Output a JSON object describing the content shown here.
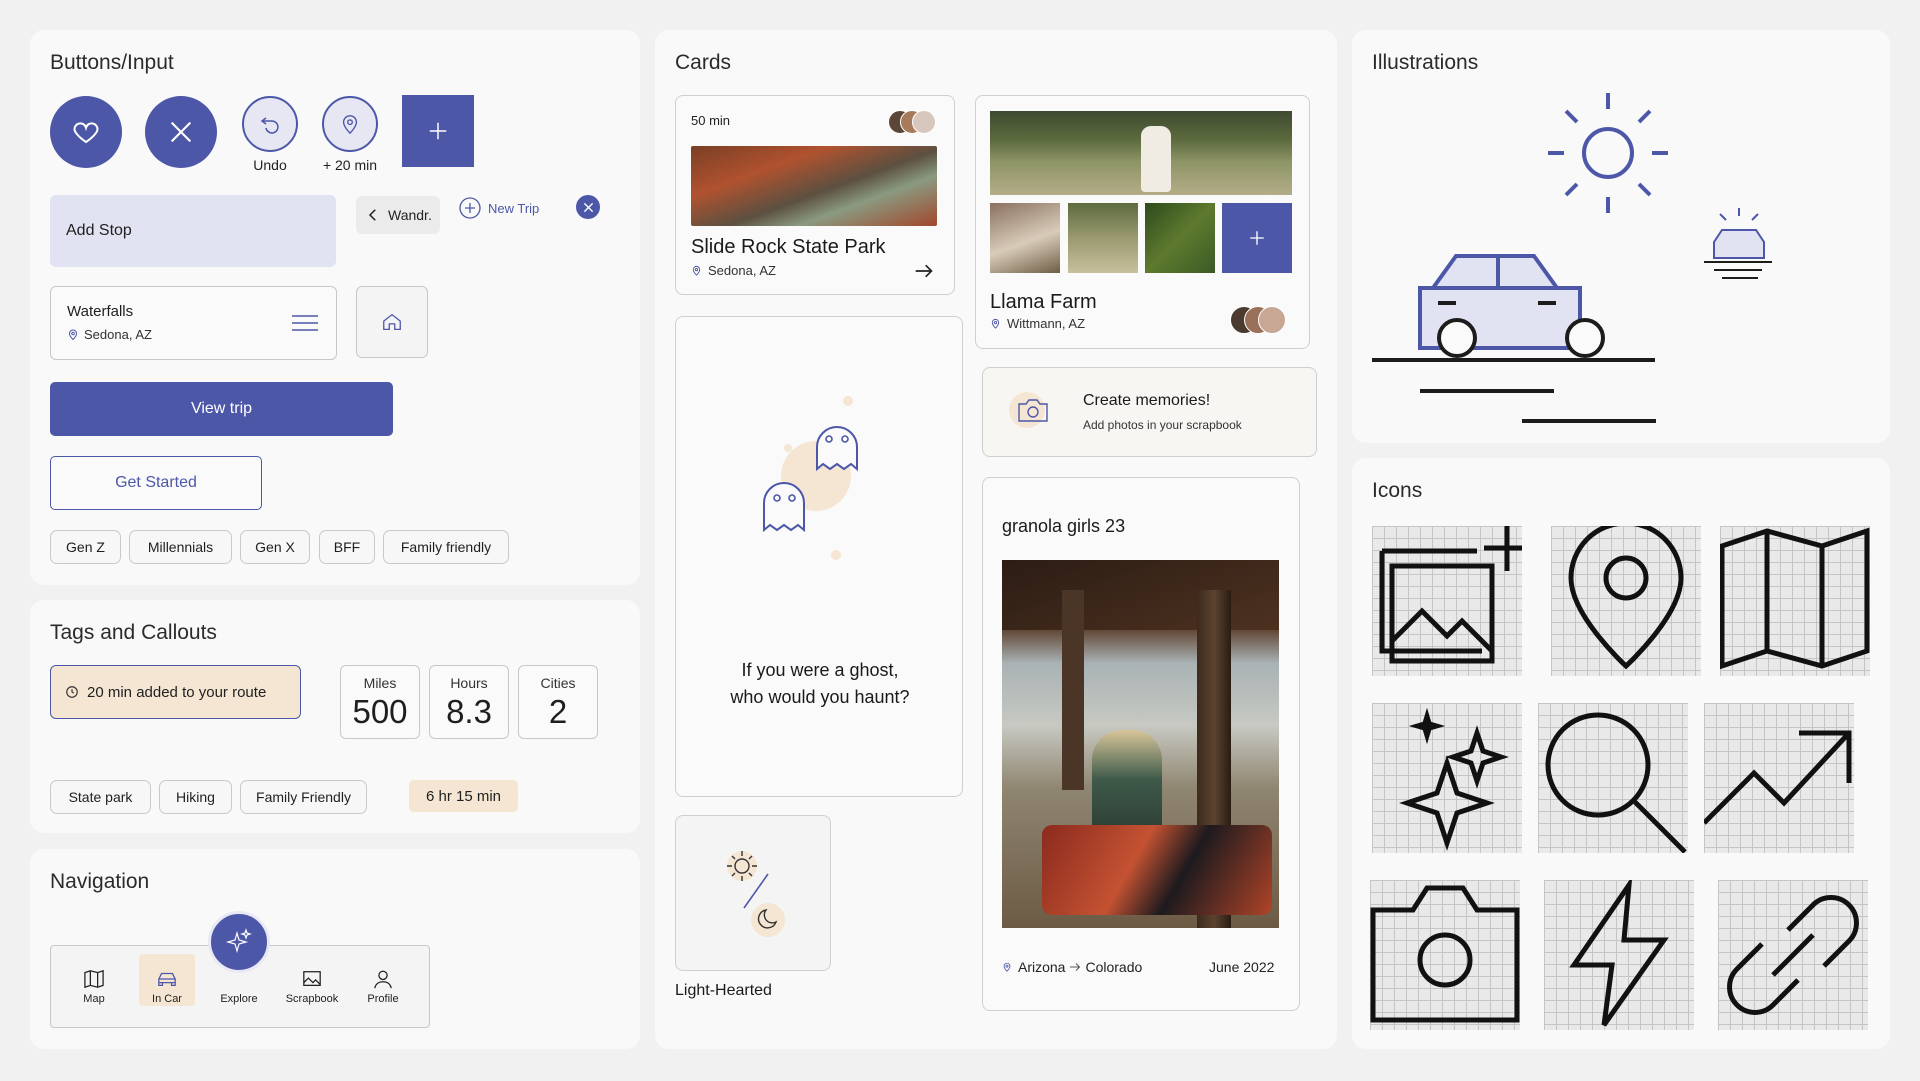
{
  "sections": {
    "buttons_input": "Buttons/Input",
    "tags_callouts": "Tags and Callouts",
    "navigation": "Navigation",
    "cards": "Cards",
    "illustrations": "Illustrations",
    "icons": "Icons"
  },
  "buttons": {
    "undo_label": "Undo",
    "add_time_label": "+ 20 min",
    "add_stop": "Add Stop",
    "back_label": "Wandr.",
    "new_trip": "New Trip",
    "waterfalls_title": "Waterfalls",
    "waterfalls_location": "Sedona, AZ",
    "view_trip": "View trip",
    "get_started": "Get Started"
  },
  "generation_chips": [
    "Gen Z",
    "Millennials",
    "Gen X",
    "BFF",
    "Family friendly"
  ],
  "tags": {
    "callout": "20 min added to your route",
    "stats": [
      {
        "label": "Miles",
        "value": "500"
      },
      {
        "label": "Hours",
        "value": "8.3"
      },
      {
        "label": "Cities",
        "value": "2"
      }
    ],
    "chips": [
      "State park",
      "Hiking",
      "Family Friendly"
    ],
    "duration": "6 hr 15 min"
  },
  "nav": {
    "items": [
      {
        "label": "Map",
        "icon": "map-icon"
      },
      {
        "label": "In Car",
        "icon": "car-icon"
      },
      {
        "label": "Explore",
        "icon": "sparkle-icon"
      },
      {
        "label": "Scrapbook",
        "icon": "image-icon"
      },
      {
        "label": "Profile",
        "icon": "user-icon"
      }
    ]
  },
  "cards": {
    "slide_rock": {
      "duration": "50 min",
      "title": "Slide Rock State Park",
      "location": "Sedona, AZ"
    },
    "llama": {
      "title": "Llama Farm",
      "location": "Wittmann, AZ"
    },
    "ghost": {
      "line1": "If you were a ghost,",
      "line2": "who would you haunt?"
    },
    "memories": {
      "title": "Create memories!",
      "subtitle": "Add photos in your scrapbook"
    },
    "light_hearted": "Light-Hearted",
    "scrapbook": {
      "title": "granola girls 23",
      "from": "Arizona",
      "to": "Colorado",
      "date": "June 2022"
    }
  },
  "colors": {
    "primary": "#4d57a8",
    "primary_light": "#e1e3f3",
    "accent_peach": "#f5e6d3",
    "background": "#f1f1f1",
    "panel": "#f9f9f9"
  }
}
